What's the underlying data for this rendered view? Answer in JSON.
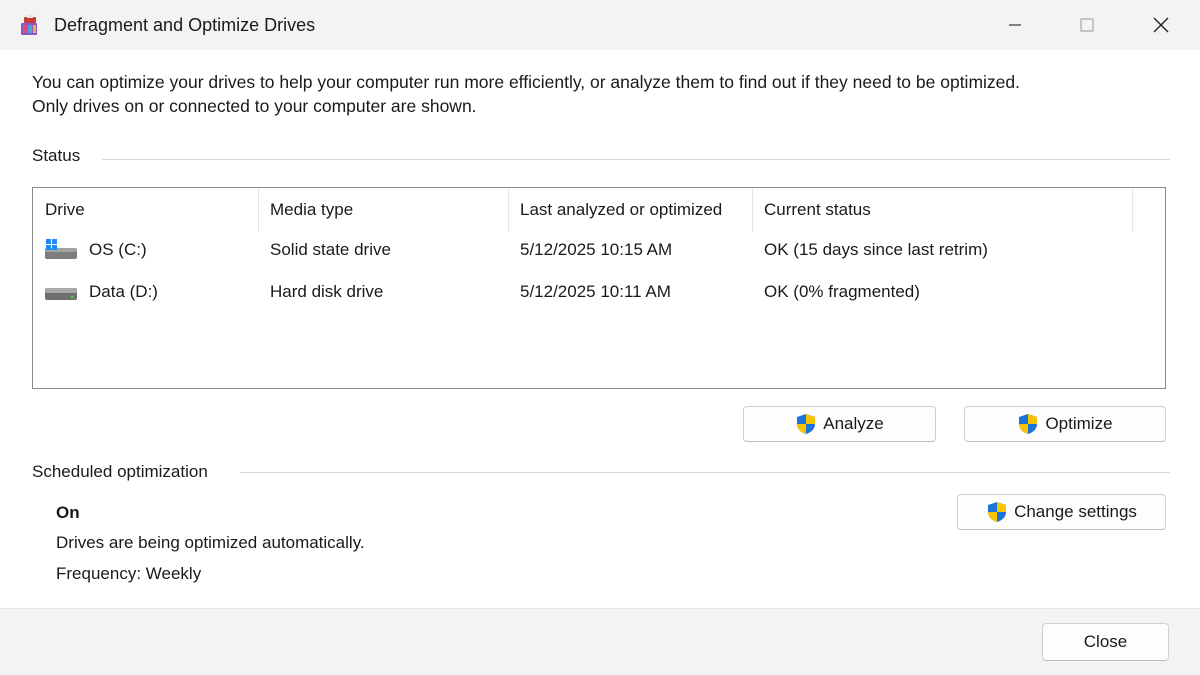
{
  "window": {
    "title": "Defragment and Optimize Drives"
  },
  "intro": {
    "line1": "You can optimize your drives to help your computer run more efficiently, or analyze them to find out if they need to be optimized.",
    "line2": "Only drives on or connected to your computer are shown."
  },
  "status": {
    "label": "Status",
    "columns": [
      "Drive",
      "Media type",
      "Last analyzed or optimized",
      "Current status"
    ],
    "drives": [
      {
        "name": "OS (C:)",
        "icon": "system-drive-icon",
        "media_type": "Solid state drive",
        "last": "5/12/2025 10:15 AM",
        "current_status": "OK (15 days since last retrim)"
      },
      {
        "name": "Data (D:)",
        "icon": "hard-drive-icon",
        "media_type": "Hard disk drive",
        "last": "5/12/2025 10:11 AM",
        "current_status": "OK (0% fragmented)"
      }
    ]
  },
  "buttons": {
    "analyze": "Analyze",
    "optimize": "Optimize",
    "change_settings": "Change settings",
    "close": "Close"
  },
  "scheduled": {
    "label": "Scheduled optimization",
    "state": "On",
    "description": "Drives are being optimized automatically.",
    "frequency": "Frequency: Weekly"
  },
  "colors": {
    "shield_blue": "#1e73d8",
    "shield_yellow": "#f6c400",
    "windows_blue": "#1f8bf0"
  }
}
